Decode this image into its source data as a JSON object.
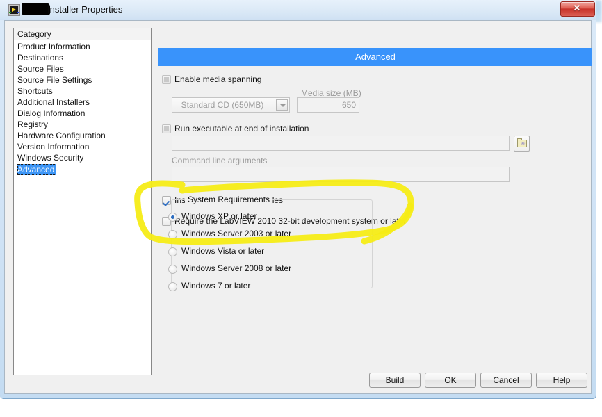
{
  "window": {
    "title": "Installer Properties",
    "redacted_prefix": true,
    "app_icon": "labview-vi-icon",
    "close_label": "✕"
  },
  "background": {
    "description": "blurred application window behind dialog"
  },
  "category": {
    "header": "Category",
    "items": [
      "Product Information",
      "Destinations",
      "Source Files",
      "Source File Settings",
      "Shortcuts",
      "Additional Installers",
      "Dialog Information",
      "Registry",
      "Hardware Configuration",
      "Version Information",
      "Windows Security",
      "Advanced"
    ],
    "selected": "Advanced",
    "selected_index": 11
  },
  "pane": {
    "header": "Advanced",
    "header_color": "#3993fb",
    "media_spanning": {
      "label": "Enable media spanning",
      "checked": false,
      "combo_value": "Standard CD (650MB)",
      "combo_disabled": true,
      "media_size_label": "Media size (MB)",
      "media_size_value": "650",
      "media_size_disabled": true
    },
    "run_executable": {
      "label": "Run executable at end of installation",
      "checked": false,
      "path_value": "",
      "path_disabled": true,
      "browse_icon": "folder-browse-icon",
      "cmdline_label": "Command line arguments",
      "cmdline_value": "",
      "cmdline_disabled": true
    },
    "install_error_codes": {
      "label": "Install custom error code files",
      "checked": true
    },
    "require_labview": {
      "label": "Require the LabVIEW 2010 32-bit development system or later",
      "checked": false
    },
    "system_requirements": {
      "legend": "System Requirements",
      "options": [
        "Windows XP or later",
        "Windows Server 2003 or later",
        "Windows Vista or later",
        "Windows Server 2008 or later",
        "Windows 7 or later"
      ],
      "selected_index": 0
    }
  },
  "buttons": [
    {
      "label": "Build"
    },
    {
      "label": "OK"
    },
    {
      "label": "Cancel"
    },
    {
      "label": "Help"
    }
  ],
  "annotation": {
    "type": "highlighter-ellipse",
    "color": "#f7f000",
    "encircles": "Require the LabVIEW 2010 32-bit development system or later"
  }
}
